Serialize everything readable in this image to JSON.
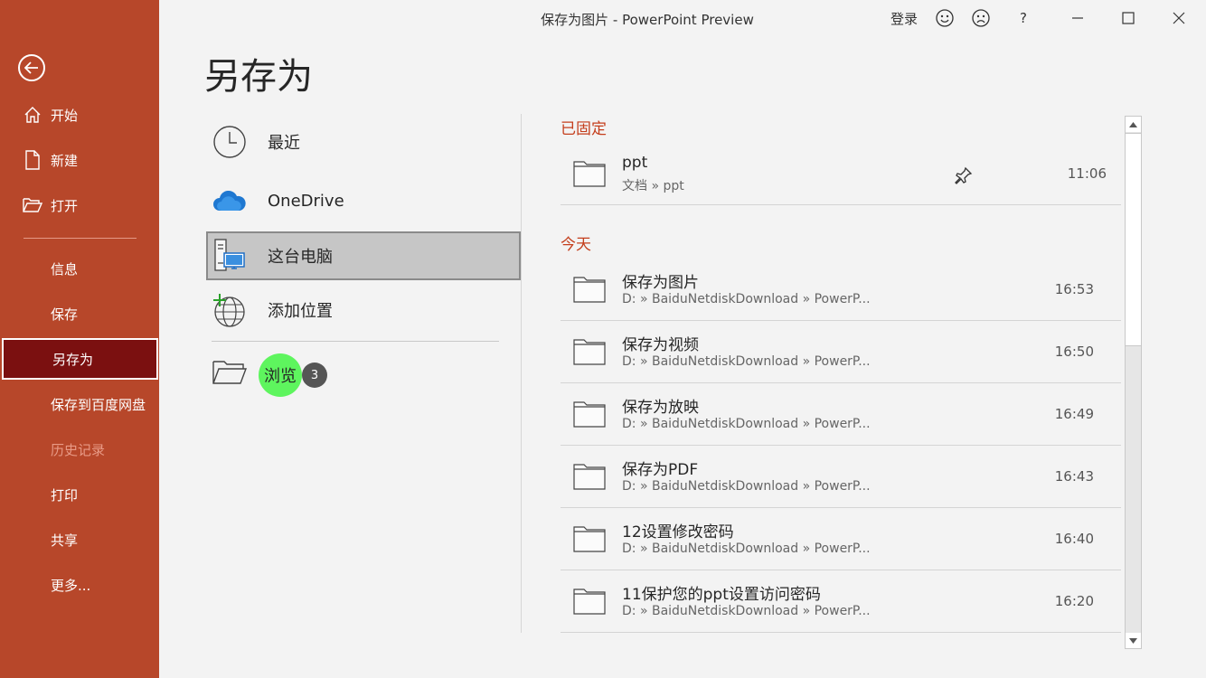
{
  "window": {
    "title": "保存为图片  -  PowerPoint Preview",
    "signin": "登录",
    "help": "?"
  },
  "colors": {
    "accent": "#b7472a",
    "selected_nav": "#7b1010",
    "section_head": "#c43e1c"
  },
  "sidebar": {
    "items": [
      {
        "label": "开始",
        "icon": "home-icon"
      },
      {
        "label": "新建",
        "icon": "new-file-icon"
      },
      {
        "label": "打开",
        "icon": "open-folder-icon"
      },
      {
        "label": "信息"
      },
      {
        "label": "保存"
      },
      {
        "label": "另存为",
        "selected": true
      },
      {
        "label": "保存到百度网盘"
      },
      {
        "label": "历史记录",
        "disabled": true
      },
      {
        "label": "打印"
      },
      {
        "label": "共享"
      },
      {
        "label": "更多..."
      }
    ]
  },
  "page": {
    "title": "另存为"
  },
  "locations": {
    "items": [
      {
        "label": "最近",
        "icon": "clock-icon"
      },
      {
        "label": "OneDrive",
        "icon": "onedrive-cloud-icon"
      },
      {
        "label": "这台电脑",
        "icon": "this-pc-icon",
        "selected": true
      },
      {
        "label": "添加位置",
        "icon": "add-location-globe-icon"
      }
    ],
    "browse": {
      "label": "浏览",
      "badge": "3",
      "icon": "browse-folder-icon"
    }
  },
  "recent": {
    "pinned_header": "已固定",
    "today_header": "今天",
    "pinned": [
      {
        "name": "ppt",
        "path": "文档 » ppt",
        "time": "11:06"
      }
    ],
    "today": [
      {
        "name": "保存为图片",
        "path": "D: » BaiduNetdiskDownload » PowerP...",
        "time": "16:53"
      },
      {
        "name": "保存为视频",
        "path": "D: » BaiduNetdiskDownload » PowerP...",
        "time": "16:50"
      },
      {
        "name": "保存为放映",
        "path": "D: » BaiduNetdiskDownload » PowerP...",
        "time": "16:49"
      },
      {
        "name": "保存为PDF",
        "path": "D: » BaiduNetdiskDownload » PowerP...",
        "time": "16:43"
      },
      {
        "name": "12设置修改密码",
        "path": "D: » BaiduNetdiskDownload » PowerP...",
        "time": "16:40"
      },
      {
        "name": "11保护您的ppt设置访问密码",
        "path": "D: » BaiduNetdiskDownload » PowerP...",
        "time": "16:20"
      }
    ]
  }
}
